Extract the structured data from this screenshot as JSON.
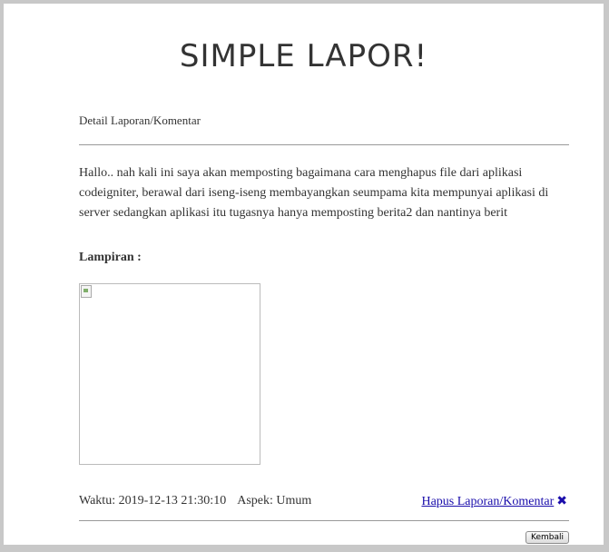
{
  "header": {
    "title": "SIMPLE LAPOR!"
  },
  "detail": {
    "section_title": "Detail Laporan/Komentar",
    "body": "Hallo.. nah kali ini saya akan memposting bagaimana cara menghapus file dari aplikasi codeigniter, berawal dari iseng-iseng membayangkan seumpama kita mempunyai aplikasi di server sedangkan aplikasi itu tugasnya hanya memposting berita2 dan nantinya berit",
    "attachment_label": "Lampiran :",
    "time_text": "Waktu: 2019-12-13 21:30:10",
    "aspect_text": "Aspek: Umum",
    "delete_label": "Hapus Laporan/Komentar",
    "delete_icon": "close-icon"
  },
  "actions": {
    "back_label": "Kembali"
  },
  "colors": {
    "link": "#1a0dab",
    "background": "#c8c8c8",
    "page": "#ffffff"
  }
}
